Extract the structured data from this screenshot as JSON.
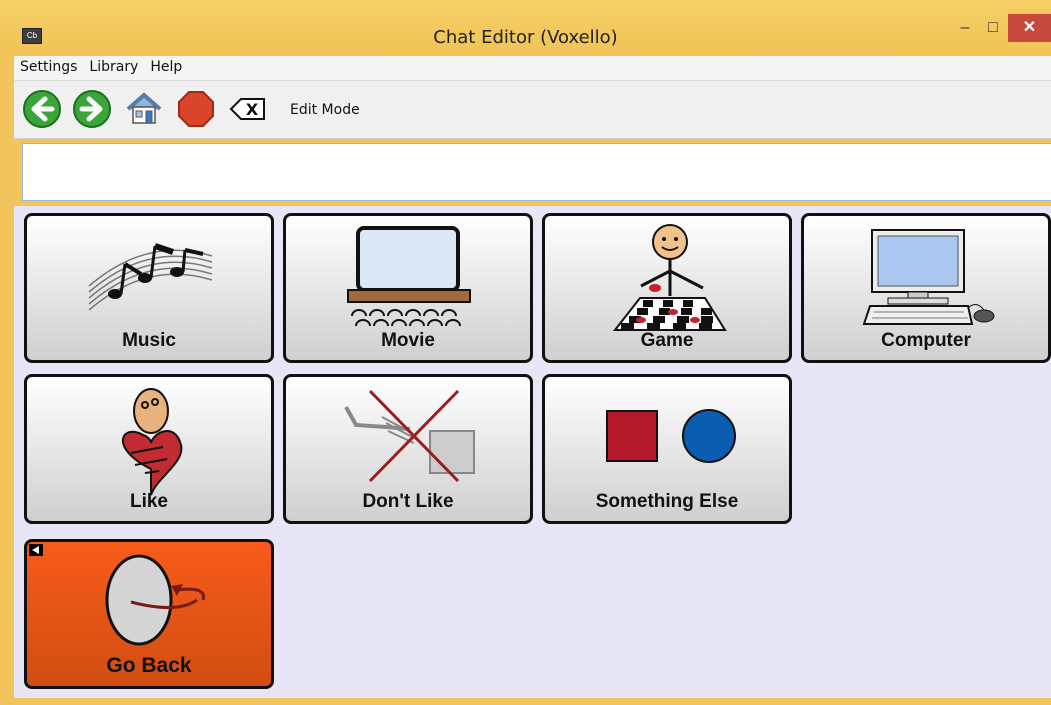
{
  "window": {
    "title": "Chat Editor (Voxello)",
    "app_icon_text": "Cb"
  },
  "menu": {
    "items": [
      "Settings",
      "Library",
      "Help"
    ]
  },
  "toolbar": {
    "edit_mode_label": "Edit Mode",
    "clear_symbol": "X"
  },
  "message": {
    "value": ""
  },
  "cells": [
    {
      "label": "Music",
      "icon": "music-notes-icon"
    },
    {
      "label": "Movie",
      "icon": "movie-theater-icon"
    },
    {
      "label": "Game",
      "icon": "game-checkers-icon"
    },
    {
      "label": "Computer",
      "icon": "computer-icon"
    },
    {
      "label": "Like",
      "icon": "like-heart-icon"
    },
    {
      "label": "Don't Like",
      "icon": "dont-like-icon"
    },
    {
      "label": "Something Else",
      "icon": "square-circle-icon"
    },
    {
      "label": "Go Back",
      "icon": "go-back-icon"
    }
  ],
  "colors": {
    "titlebar": "#f0c356",
    "close": "#c74a3d",
    "grid_bg": "#e6e6f7",
    "go_back": "#f75b1b"
  }
}
